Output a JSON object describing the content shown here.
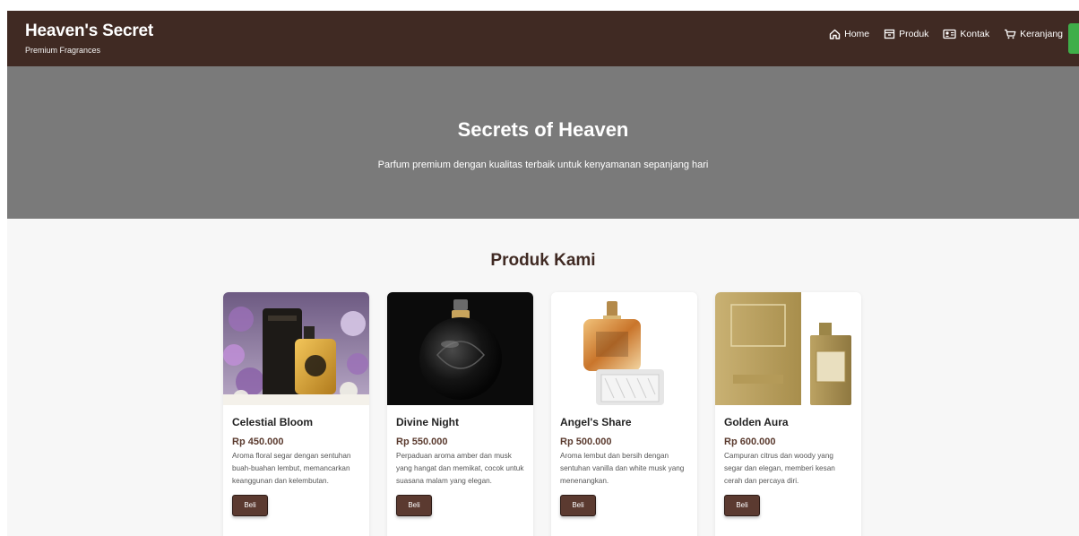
{
  "header": {
    "brand_title": "Heaven's Secret",
    "brand_tagline": "Premium Fragrances",
    "nav": [
      {
        "label": "Home",
        "icon": "home-icon"
      },
      {
        "label": "Produk",
        "icon": "box-icon"
      },
      {
        "label": "Kontak",
        "icon": "contact-card-icon"
      },
      {
        "label": "Keranjang",
        "icon": "cart-icon"
      }
    ]
  },
  "hero": {
    "title": "Secrets of Heaven",
    "subtitle": "Parfum premium dengan kualitas terbaik untuk kenyamanan sepanjang hari"
  },
  "products_section": {
    "title": "Produk Kami",
    "items": [
      {
        "name": "Celestial Bloom",
        "price": "Rp 450.000",
        "description": "Aroma floral segar dengan sentuhan buah-buahan lembut, memancarkan keanggunan dan kelembutan.",
        "button": "Beli"
      },
      {
        "name": "Divine Night",
        "price": "Rp 550.000",
        "description": "Perpaduan aroma amber dan musk yang hangat dan memikat, cocok untuk suasana malam yang elegan.",
        "button": "Beli"
      },
      {
        "name": "Angel's Share",
        "price": "Rp 500.000",
        "description": "Aroma lembut dan bersih dengan sentuhan vanilla dan white musk yang menenangkan.",
        "button": "Beli"
      },
      {
        "name": "Golden Aura",
        "price": "Rp 600.000",
        "description": "Campuran citrus dan woody yang segar dan elegan, memberi kesan cerah dan percaya diri.",
        "button": "Beli"
      }
    ]
  },
  "colors": {
    "header_bg": "#402a23",
    "hero_bg": "#7a7a7a",
    "button_bg": "#5b3a30",
    "accent_green": "#3fae49"
  }
}
